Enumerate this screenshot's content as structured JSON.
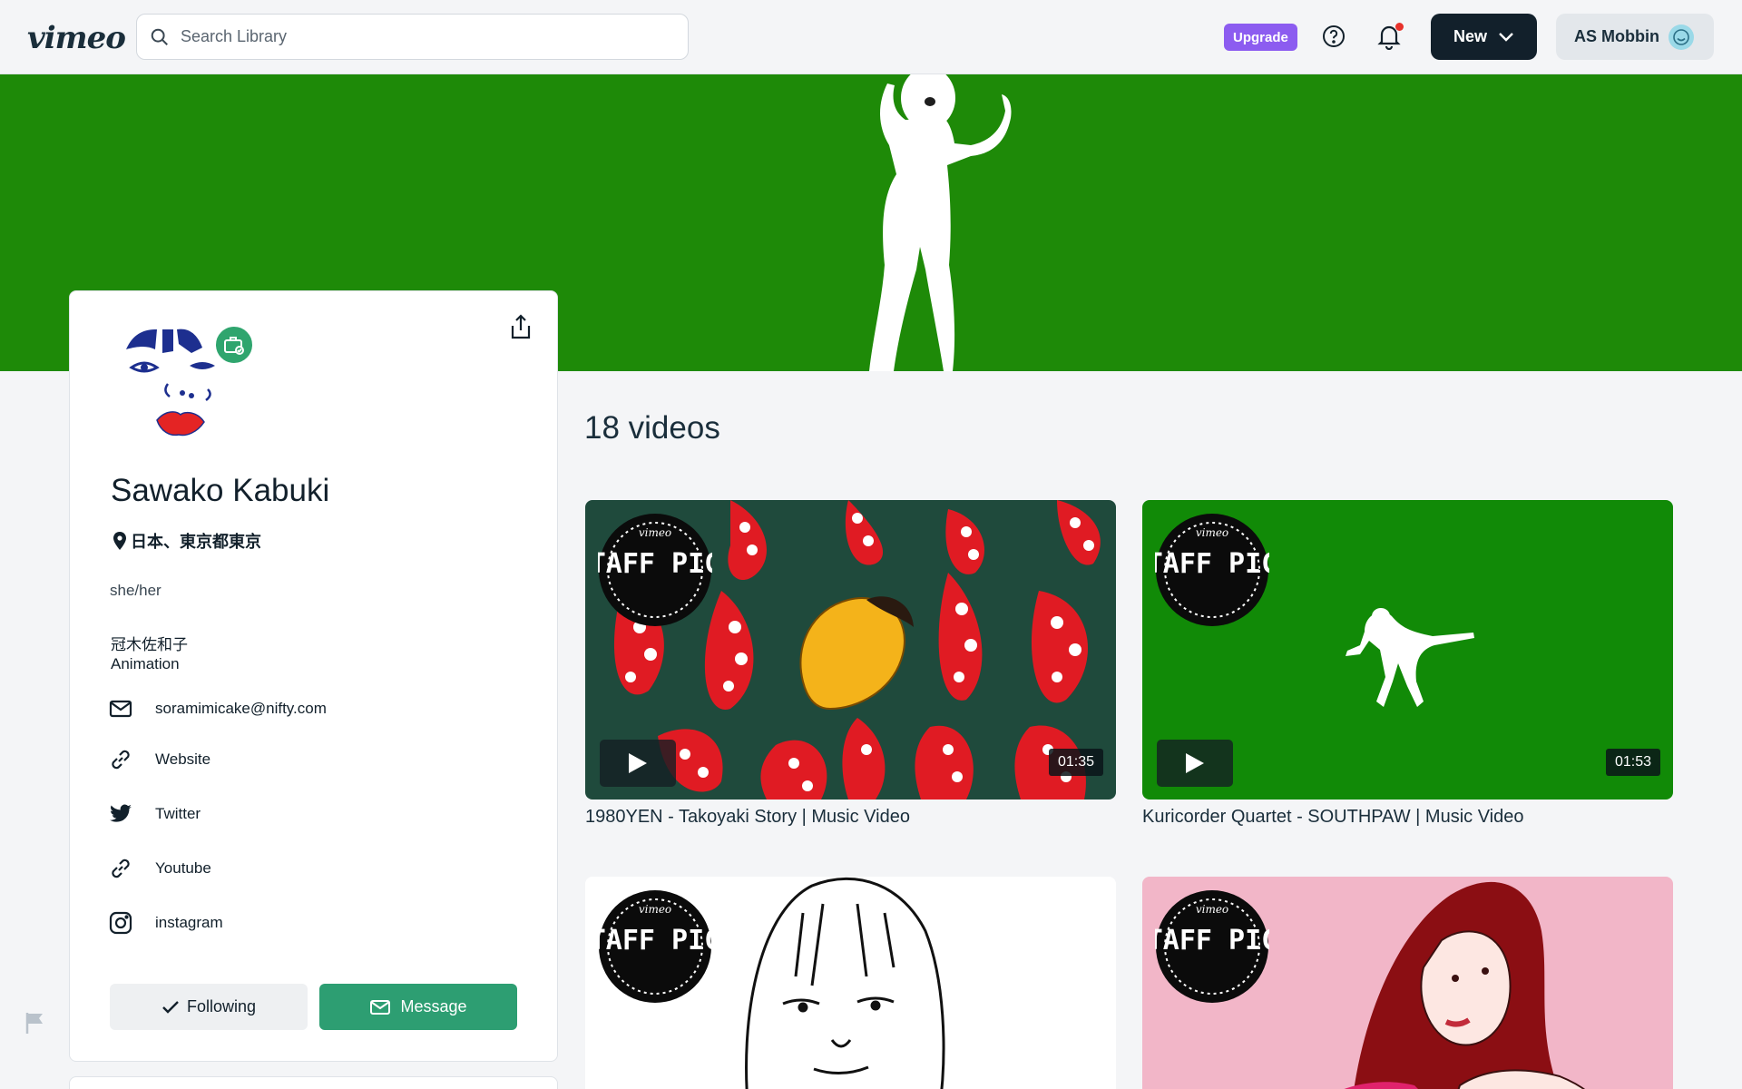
{
  "header": {
    "logo": "vimeo",
    "search_placeholder": "Search Library",
    "upgrade_label": "Upgrade",
    "new_label": "New",
    "user_label": "AS Mobbin"
  },
  "profile": {
    "name": "Sawako Kabuki",
    "location": "日本、東京都東京",
    "pronouns": "she/her",
    "bio_line1": "冠木佐和子",
    "bio_line2": "Animation",
    "links": [
      {
        "label": "soramimicake@nifty.com",
        "icon": "mail-icon"
      },
      {
        "label": "Website",
        "icon": "link-icon"
      },
      {
        "label": "Twitter",
        "icon": "twitter-icon"
      },
      {
        "label": "Youtube",
        "icon": "link-icon"
      },
      {
        "label": "instagram",
        "icon": "instagram-icon"
      }
    ],
    "following_label": "Following",
    "message_label": "Message"
  },
  "videos": {
    "count_label": "18 videos",
    "items": [
      {
        "title": "1980YEN - Takoyaki Story | Music Video",
        "duration": "01:35",
        "staff_pick": "STAFF PICK"
      },
      {
        "title": "Kuricorder Quartet - SOUTHPAW | Music Video",
        "duration": "01:53",
        "staff_pick": "STAFF PICK"
      },
      {
        "title": "",
        "duration": "",
        "staff_pick": "STAFF PICK"
      },
      {
        "title": "",
        "duration": "",
        "staff_pick": "STAFF PICK"
      }
    ]
  },
  "colors": {
    "banner_green": "#1e8a08",
    "upgrade_purple": "#8c5cf0",
    "message_green": "#2d9e72",
    "dark": "#12202b"
  }
}
